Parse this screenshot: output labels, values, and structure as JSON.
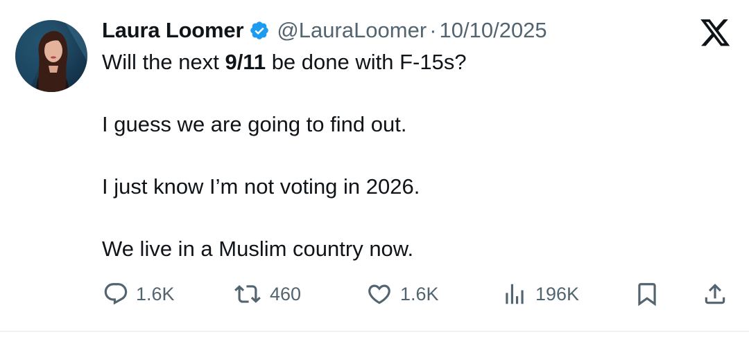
{
  "author": {
    "name": "Laura Loomer",
    "handle": "@LauraLoomer",
    "separator": "·",
    "date": "10/10/2025",
    "verified_color": "#1d9bf0"
  },
  "tweet": {
    "line1_before": "Will the next ",
    "line1_bold": "9/11",
    "line1_after": " be done with F-15s?",
    "line2": "I guess we are going to find out.",
    "line3": "I just know I’m not voting in 2026.",
    "line4": "We live in a Muslim country now."
  },
  "actions": {
    "replies": "1.6K",
    "reposts": "460",
    "likes": "1.6K",
    "views": "196K"
  },
  "icons": {
    "reply": "speech-bubble-icon",
    "repost": "repost-arrows-icon",
    "like": "heart-icon",
    "views": "bar-chart-icon",
    "bookmark": "bookmark-icon",
    "share": "share-upload-icon",
    "logo": "x-logo-icon"
  },
  "colors": {
    "text": "#0f1419",
    "muted": "#536471",
    "verified": "#1d9bf0"
  }
}
